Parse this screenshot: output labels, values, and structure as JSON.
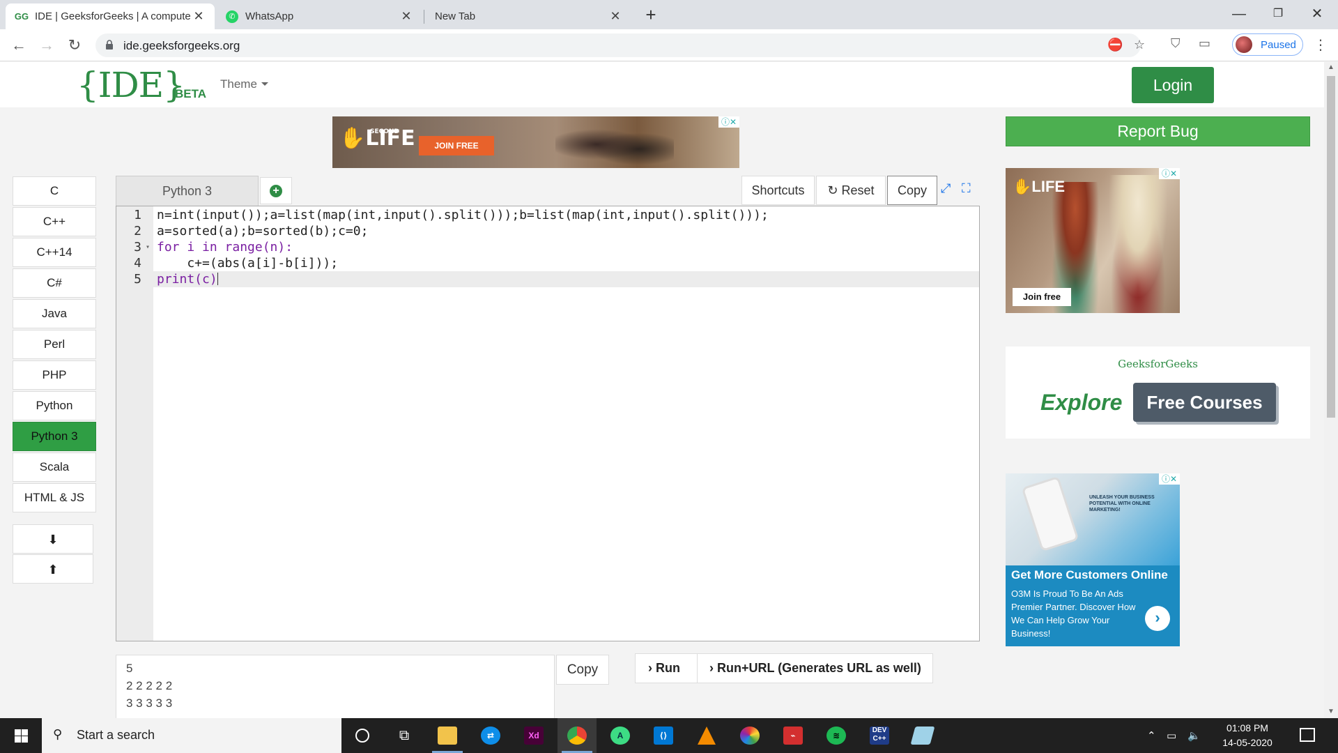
{
  "browser": {
    "tabs": [
      {
        "title": "IDE | GeeksforGeeks | A compute",
        "active": true
      },
      {
        "title": "WhatsApp",
        "active": false
      },
      {
        "title": "New Tab",
        "active": false
      }
    ],
    "url": "ide.geeksforgeeks.org",
    "profile_label": "Paused"
  },
  "header": {
    "logo": "{IDE}",
    "beta": "BETA",
    "theme": "Theme",
    "login": "Login"
  },
  "ads": {
    "top_join": "JOIN FREE",
    "top_brand": "LIFE",
    "top_brand_small": "SECOND",
    "side1_brand": "LIFE",
    "side1_join": "Join free",
    "side2_tagline": "UNLEASH YOUR BUSINESS POTENTIAL WITH ONLINE MARKETING!",
    "side2_heading": "Get More Customers Online",
    "side2_body": "O3M Is Proud To Be An Ads Premier Partner. Discover How We Can Help Grow Your Business!"
  },
  "report_bug": "Report Bug",
  "promo": {
    "brand": "GeeksforGeeks",
    "explore": "Explore",
    "button": "Free Courses"
  },
  "languages": [
    "C",
    "C++",
    "C++14",
    "C#",
    "Java",
    "Perl",
    "PHP",
    "Python",
    "Python 3",
    "Scala",
    "HTML & JS"
  ],
  "selected_language": "Python 3",
  "editor": {
    "tab_label": "Python 3",
    "toolbar": {
      "shortcuts": "Shortcuts",
      "reset": "Reset",
      "copy": "Copy"
    },
    "lines": [
      "n=int(input());a=list(map(int,input().split()));b=list(map(int,input().split()));",
      "a=sorted(a);b=sorted(b);c=0;",
      "for i in range(n):",
      "    c+=(abs(a[i]-b[i]));",
      "print(c)"
    ]
  },
  "stdin": {
    "lines": [
      "5",
      "2 2 2 2 2",
      "3 3 3 3 3"
    ],
    "copy": "Copy"
  },
  "run": {
    "run": "Run",
    "run_url": "Run+URL (Generates URL as well)"
  },
  "taskbar": {
    "search": "Start a search",
    "time": "01:08 PM",
    "date": "14-05-2020"
  },
  "colors": {
    "gfg_green": "#2f8d46",
    "report_bug": "#4caf50",
    "active_lang": "#2f9e44"
  }
}
